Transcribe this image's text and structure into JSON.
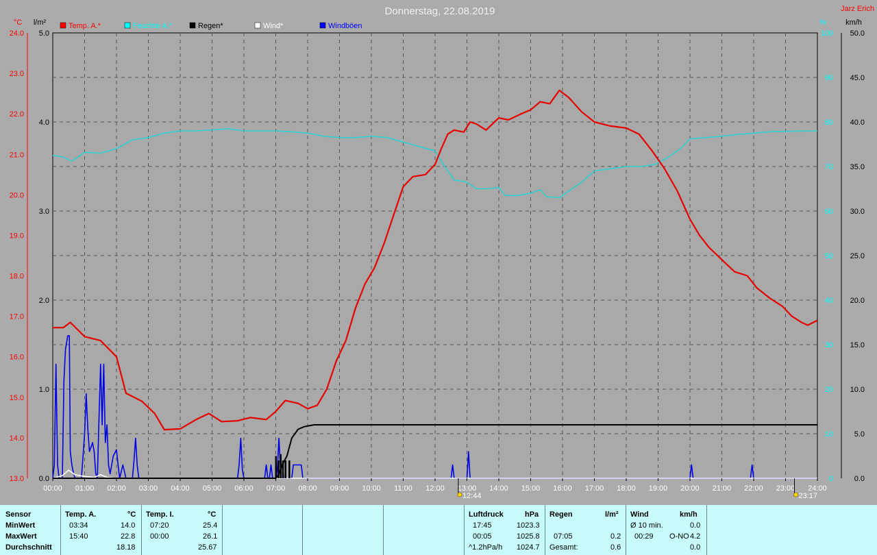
{
  "header": {
    "title": "Donnerstag, 22.08.2019",
    "author": "Jarz Erich",
    "unit_temp": "°C",
    "unit_rain": "l/m²",
    "unit_pct": "%",
    "unit_wind": "km/h"
  },
  "chart_data": {
    "type": "line",
    "x_ticks": [
      "00:00",
      "01:00",
      "02:00",
      "03:00",
      "04:00",
      "05:00",
      "06:00",
      "07:00",
      "08:00",
      "09:00",
      "10:00",
      "11:00",
      "12:00",
      "13:00",
      "14:00",
      "15:00",
      "16:00",
      "17:00",
      "18:00",
      "19:00",
      "20:00",
      "21:00",
      "22:00",
      "23:00",
      "24:00"
    ],
    "axes": {
      "temp": {
        "ticks": [
          "13.0",
          "14.0",
          "15.0",
          "16.0",
          "17.0",
          "18.0",
          "19.0",
          "20.0",
          "21.0",
          "22.0",
          "23.0",
          "24.0"
        ],
        "range": [
          13,
          24
        ]
      },
      "rain": {
        "ticks": [
          "0.0",
          "1.0",
          "2.0",
          "3.0",
          "4.0",
          "5.0"
        ],
        "range": [
          0,
          5
        ]
      },
      "pct": {
        "ticks": [
          "0",
          "10",
          "20",
          "30",
          "40",
          "50",
          "60",
          "70",
          "80",
          "90",
          "100"
        ],
        "range": [
          0,
          100
        ]
      },
      "wind": {
        "ticks": [
          "0.0",
          "5.0",
          "10.0",
          "15.0",
          "20.0",
          "25.0",
          "30.0",
          "35.0",
          "40.0",
          "45.0",
          "50.0"
        ],
        "range": [
          0,
          50
        ]
      }
    },
    "legend": [
      "Temp. A.*",
      "Feuchte A.*",
      "Regen*",
      "Wind*",
      "Windböen"
    ],
    "legend_colors": [
      "#ff0000",
      "#00ffff",
      "#000000",
      "#ffffff",
      "#0000ff"
    ],
    "sun": {
      "sunrise": "12:44",
      "sunset": "23:17"
    },
    "series": [
      {
        "name": "Temp. A.*",
        "color": "#e60000",
        "axis": "temp",
        "points": [
          [
            0,
            16.72
          ],
          [
            0.33,
            16.72
          ],
          [
            0.55,
            16.85
          ],
          [
            1.0,
            16.5
          ],
          [
            1.5,
            16.4
          ],
          [
            2.0,
            16.0
          ],
          [
            2.3,
            15.1
          ],
          [
            2.8,
            14.9
          ],
          [
            3.2,
            14.6
          ],
          [
            3.5,
            14.2
          ],
          [
            4.0,
            14.22
          ],
          [
            4.5,
            14.45
          ],
          [
            4.9,
            14.6
          ],
          [
            5.3,
            14.4
          ],
          [
            5.8,
            14.42
          ],
          [
            6.2,
            14.5
          ],
          [
            6.7,
            14.45
          ],
          [
            7.0,
            14.65
          ],
          [
            7.3,
            14.92
          ],
          [
            7.7,
            14.85
          ],
          [
            8.0,
            14.72
          ],
          [
            8.3,
            14.8
          ],
          [
            8.6,
            15.2
          ],
          [
            8.9,
            15.9
          ],
          [
            9.2,
            16.4
          ],
          [
            9.5,
            17.2
          ],
          [
            9.8,
            17.8
          ],
          [
            10.1,
            18.2
          ],
          [
            10.4,
            18.8
          ],
          [
            10.7,
            19.5
          ],
          [
            11.0,
            20.2
          ],
          [
            11.3,
            20.45
          ],
          [
            11.7,
            20.5
          ],
          [
            12.0,
            20.75
          ],
          [
            12.2,
            21.15
          ],
          [
            12.4,
            21.5
          ],
          [
            12.6,
            21.6
          ],
          [
            12.9,
            21.55
          ],
          [
            13.1,
            21.8
          ],
          [
            13.3,
            21.75
          ],
          [
            13.6,
            21.6
          ],
          [
            14.0,
            21.9
          ],
          [
            14.3,
            21.85
          ],
          [
            14.7,
            22.0
          ],
          [
            15.0,
            22.1
          ],
          [
            15.3,
            22.3
          ],
          [
            15.6,
            22.25
          ],
          [
            15.9,
            22.58
          ],
          [
            16.2,
            22.4
          ],
          [
            16.6,
            22.05
          ],
          [
            17.0,
            21.8
          ],
          [
            17.5,
            21.7
          ],
          [
            18.0,
            21.65
          ],
          [
            18.4,
            21.5
          ],
          [
            18.8,
            21.1
          ],
          [
            19.2,
            20.65
          ],
          [
            19.6,
            20.1
          ],
          [
            20.0,
            19.4
          ],
          [
            20.3,
            19.0
          ],
          [
            20.6,
            18.7
          ],
          [
            21.0,
            18.4
          ],
          [
            21.4,
            18.1
          ],
          [
            21.8,
            18.0
          ],
          [
            22.1,
            17.7
          ],
          [
            22.5,
            17.45
          ],
          [
            22.9,
            17.25
          ],
          [
            23.2,
            17.0
          ],
          [
            23.5,
            16.85
          ],
          [
            23.7,
            16.78
          ],
          [
            24.0,
            16.9
          ]
        ]
      },
      {
        "name": "Feuchte A.*",
        "color": "#30d0d0",
        "axis": "pct",
        "points": [
          [
            0,
            72.5
          ],
          [
            0.3,
            72.2
          ],
          [
            0.6,
            71.2
          ],
          [
            1.0,
            73.2
          ],
          [
            1.5,
            73.0
          ],
          [
            2.0,
            74.0
          ],
          [
            2.5,
            76.0
          ],
          [
            3.0,
            76.5
          ],
          [
            3.5,
            77.5
          ],
          [
            4.0,
            78.0
          ],
          [
            4.5,
            78.0
          ],
          [
            5.0,
            78.2
          ],
          [
            5.5,
            78.5
          ],
          [
            6.0,
            78.0
          ],
          [
            6.5,
            78.0
          ],
          [
            7.0,
            78.0
          ],
          [
            7.5,
            77.8
          ],
          [
            8.0,
            77.5
          ],
          [
            8.5,
            76.8
          ],
          [
            9.0,
            76.5
          ],
          [
            9.5,
            76.5
          ],
          [
            10.0,
            76.8
          ],
          [
            10.5,
            76.5
          ],
          [
            11.0,
            75.5
          ],
          [
            11.5,
            74.5
          ],
          [
            12.0,
            73.5
          ],
          [
            12.3,
            70.0
          ],
          [
            12.6,
            67.0
          ],
          [
            13.0,
            66.5
          ],
          [
            13.3,
            65.0
          ],
          [
            13.7,
            65.0
          ],
          [
            14.0,
            65.3
          ],
          [
            14.2,
            63.5
          ],
          [
            14.6,
            63.5
          ],
          [
            15.0,
            64.0
          ],
          [
            15.3,
            64.8
          ],
          [
            15.5,
            63.2
          ],
          [
            15.9,
            63.0
          ],
          [
            16.2,
            64.5
          ],
          [
            16.6,
            66.5
          ],
          [
            17.0,
            69.0
          ],
          [
            17.5,
            69.5
          ],
          [
            18.0,
            70.0
          ],
          [
            18.5,
            70.0
          ],
          [
            18.9,
            70.5
          ],
          [
            19.3,
            72.0
          ],
          [
            19.7,
            74.0
          ],
          [
            20.0,
            76.2
          ],
          [
            20.5,
            76.5
          ],
          [
            21.0,
            76.8
          ],
          [
            21.5,
            77.2
          ],
          [
            22.0,
            77.5
          ],
          [
            22.5,
            77.8
          ],
          [
            23.0,
            77.9
          ],
          [
            24.0,
            78.0
          ]
        ]
      },
      {
        "name": "Regen*",
        "color": "#000000",
        "axis": "rain",
        "points": [
          [
            0,
            0
          ],
          [
            7.0,
            0
          ],
          [
            7.1,
            0.05
          ],
          [
            7.2,
            0.15
          ],
          [
            7.35,
            0.25
          ],
          [
            7.5,
            0.45
          ],
          [
            7.7,
            0.55
          ],
          [
            7.9,
            0.58
          ],
          [
            8.2,
            0.6
          ],
          [
            9.0,
            0.6
          ],
          [
            12.0,
            0.6
          ],
          [
            24.0,
            0.6
          ]
        ]
      },
      {
        "name": "Wind*",
        "color": "#ffffff",
        "axis": "wind",
        "points": [
          [
            0,
            0
          ],
          [
            0.3,
            0.3
          ],
          [
            0.5,
            0.9
          ],
          [
            0.7,
            0.4
          ],
          [
            1.0,
            0.2
          ],
          [
            1.3,
            0.1
          ],
          [
            1.5,
            0.4
          ],
          [
            1.7,
            0.1
          ],
          [
            2.0,
            0.0
          ],
          [
            24.0,
            0.0
          ]
        ]
      },
      {
        "name": "Windböen",
        "color": "#0000e6",
        "axis": "wind",
        "points": [
          [
            0,
            0
          ],
          [
            0.05,
            1.5
          ],
          [
            0.1,
            12.8
          ],
          [
            0.15,
            1.5
          ],
          [
            0.2,
            0
          ],
          [
            0.3,
            0
          ],
          [
            0.35,
            11.0
          ],
          [
            0.4,
            14.5
          ],
          [
            0.47,
            16.0
          ],
          [
            0.52,
            16.0
          ],
          [
            0.55,
            3.0
          ],
          [
            0.6,
            1.5
          ],
          [
            0.65,
            0.6
          ],
          [
            0.7,
            0
          ],
          [
            0.9,
            0
          ],
          [
            0.95,
            2.5
          ],
          [
            1.0,
            5.0
          ],
          [
            1.05,
            9.5
          ],
          [
            1.1,
            5.5
          ],
          [
            1.15,
            3.0
          ],
          [
            1.25,
            4.0
          ],
          [
            1.3,
            3.0
          ],
          [
            1.35,
            0.5
          ],
          [
            1.4,
            0
          ],
          [
            1.45,
            6.5
          ],
          [
            1.5,
            12.8
          ],
          [
            1.55,
            6.0
          ],
          [
            1.6,
            12.8
          ],
          [
            1.65,
            4.0
          ],
          [
            1.7,
            6.0
          ],
          [
            1.75,
            1.5
          ],
          [
            1.8,
            0.5
          ],
          [
            1.85,
            1.5
          ],
          [
            1.9,
            2.5
          ],
          [
            2.0,
            3.2
          ],
          [
            2.05,
            1.5
          ],
          [
            2.1,
            0
          ],
          [
            2.2,
            1.5
          ],
          [
            2.3,
            0
          ],
          [
            2.5,
            0
          ],
          [
            2.55,
            2.0
          ],
          [
            2.6,
            4.5
          ],
          [
            2.65,
            1.5
          ],
          [
            2.7,
            0
          ],
          [
            5.8,
            0
          ],
          [
            5.85,
            1.5
          ],
          [
            5.9,
            4.5
          ],
          [
            5.95,
            1.0
          ],
          [
            6.0,
            0
          ],
          [
            6.65,
            0
          ],
          [
            6.7,
            1.5
          ],
          [
            6.75,
            0
          ],
          [
            6.8,
            0
          ],
          [
            6.85,
            1.5
          ],
          [
            6.9,
            0
          ],
          [
            7.0,
            0
          ],
          [
            7.05,
            1.0
          ],
          [
            7.1,
            4.5
          ],
          [
            7.15,
            1.0
          ],
          [
            7.2,
            1.5
          ],
          [
            7.25,
            0
          ],
          [
            7.5,
            0
          ],
          [
            7.55,
            1.5
          ],
          [
            7.8,
            1.5
          ],
          [
            7.85,
            0
          ],
          [
            12.5,
            0
          ],
          [
            12.55,
            1.5
          ],
          [
            12.6,
            0
          ],
          [
            13.0,
            0
          ],
          [
            13.05,
            3.0
          ],
          [
            13.1,
            0
          ],
          [
            20.0,
            0
          ],
          [
            20.05,
            1.5
          ],
          [
            20.1,
            0
          ],
          [
            21.9,
            0
          ],
          [
            21.95,
            1.5
          ],
          [
            22.0,
            0
          ],
          [
            24.0,
            0
          ]
        ]
      }
    ]
  },
  "table": {
    "headers": {
      "sensor": "Sensor",
      "tempA": "Temp. A.",
      "tempA_unit": "°C",
      "tempI": "Temp. I.",
      "tempI_unit": "°C",
      "luft": "Luftdruck",
      "luft_unit": "hPa",
      "regen": "Regen",
      "regen_unit": "l/m²",
      "wind": "Wind",
      "wind_unit": "km/h"
    },
    "rows": [
      {
        "label": "MinWert",
        "tA_time": "03:34",
        "tA_val": "14.0",
        "tI_time": "07:20",
        "tI_val": "25.4",
        "p_time": "17:45",
        "p_val": "1023.3",
        "r_time": "",
        "r_val": "",
        "w_label": "Ø 10 min.",
        "w_val": "0.0"
      },
      {
        "label": "MaxWert",
        "tA_time": "15:40",
        "tA_val": "22.8",
        "tI_time": "00:00",
        "tI_val": "26.1",
        "p_time": "00:05",
        "p_val": "1025.8",
        "r_time": "07:05",
        "r_val": "0.2",
        "w_label": "00:29",
        "w_dir": "O-NO",
        "w_val": "4.2"
      },
      {
        "label": "Durchschnitt",
        "tA_time": "",
        "tA_val": "18.18",
        "tI_time": "",
        "tI_val": "25.67",
        "p_time": "^1.2hPa/h",
        "p_val": "1024.7",
        "r_time": "Gesamt:",
        "r_val": "0.6",
        "w_label": "",
        "w_val": "0.0"
      }
    ]
  }
}
